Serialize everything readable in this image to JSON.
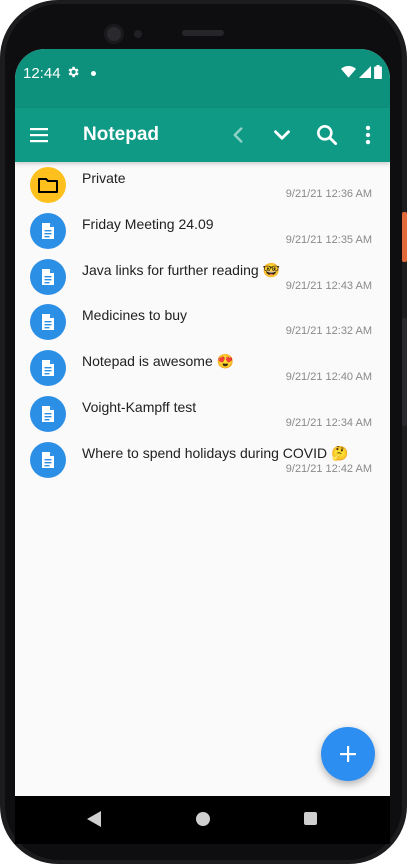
{
  "status_bar": {
    "time": "12:44",
    "settings_icon": "gear-icon",
    "notification_icon": "dot-icon",
    "wifi_icon": "wifi-icon",
    "signal_icon": "signal-icon",
    "battery_icon": "battery-icon"
  },
  "app_bar": {
    "title": "Notepad",
    "menu_icon": "hamburger-menu-icon",
    "prev_icon": "chevron-left-icon",
    "next_icon": "chevron-down-icon",
    "search_icon": "search-icon",
    "more_icon": "more-vert-icon"
  },
  "items": [
    {
      "type": "folder",
      "title": "Private",
      "date": "9/21/21 12:36 AM"
    },
    {
      "type": "note",
      "title": "Friday Meeting 24.09",
      "date": "9/21/21 12:35 AM"
    },
    {
      "type": "note",
      "title": "Java links for further reading 🤓",
      "date": "9/21/21 12:43 AM"
    },
    {
      "type": "note",
      "title": "Medicines to buy",
      "date": "9/21/21 12:32 AM"
    },
    {
      "type": "note",
      "title": "Notepad is awesome 😍",
      "date": "9/21/21 12:40 AM"
    },
    {
      "type": "note",
      "title": "Voight-Kampff test",
      "date": "9/21/21 12:34 AM"
    },
    {
      "type": "note",
      "title": "Where to spend holidays during COVID 🤔",
      "date": "9/21/21 12:42 AM"
    }
  ],
  "fab": {
    "icon": "plus-icon"
  },
  "nav_bar": {
    "back_icon": "back-triangle-icon",
    "home_icon": "home-circle-icon",
    "recent_icon": "recents-square-icon"
  },
  "colors": {
    "status_bar": "#0d917d",
    "app_bar": "#0e9a85",
    "folder_avatar": "#fdc01c",
    "note_avatar": "#2c8fe6",
    "fab": "#2d8ef2",
    "background": "#fafafa"
  }
}
